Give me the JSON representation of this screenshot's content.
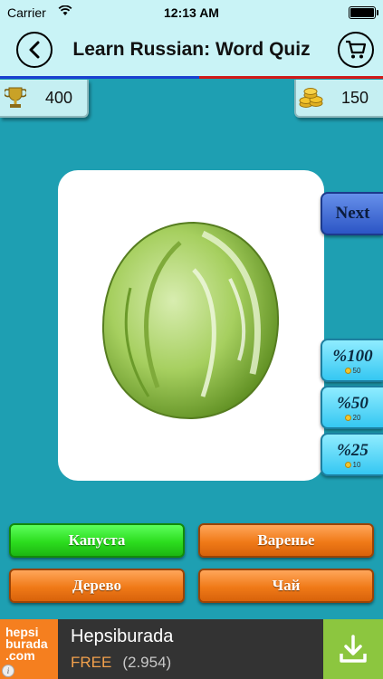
{
  "status_bar": {
    "carrier": "Carrier",
    "time": "12:13 AM",
    "battery_level": 1.0
  },
  "nav": {
    "title": "Learn Russian: Word Quiz",
    "back_icon": "chevron-left-icon",
    "cart_icon": "shopping-cart-icon"
  },
  "stats": {
    "trophy_score": "400",
    "coins": "150"
  },
  "question": {
    "image": "cabbage"
  },
  "side_buttons": {
    "next_label": "Next",
    "hints": [
      {
        "label": "%100",
        "cost": "50"
      },
      {
        "label": "%50",
        "cost": "20"
      },
      {
        "label": "%25",
        "cost": "10"
      }
    ]
  },
  "answers": [
    {
      "label": "Капуста",
      "color": "green"
    },
    {
      "label": "Варенье",
      "color": "orange"
    },
    {
      "label": "Дерево",
      "color": "orange"
    },
    {
      "label": "Чай",
      "color": "orange"
    }
  ],
  "ad": {
    "logo_text_1": "hepsi",
    "logo_text_2": "burada",
    "logo_text_3": ".com",
    "title": "Hepsiburada",
    "price": "FREE",
    "rating_count": "(2.954)",
    "info_icon": "i"
  },
  "colors": {
    "background": "#1e9fb2",
    "bar": "#c9f3f6",
    "correct": "#2cdd1e",
    "option": "#f07a18",
    "next": "#2c55c5",
    "hint": "#35c7f2",
    "ad_logo": "#f57f1f",
    "ad_download": "#8cc63f"
  }
}
